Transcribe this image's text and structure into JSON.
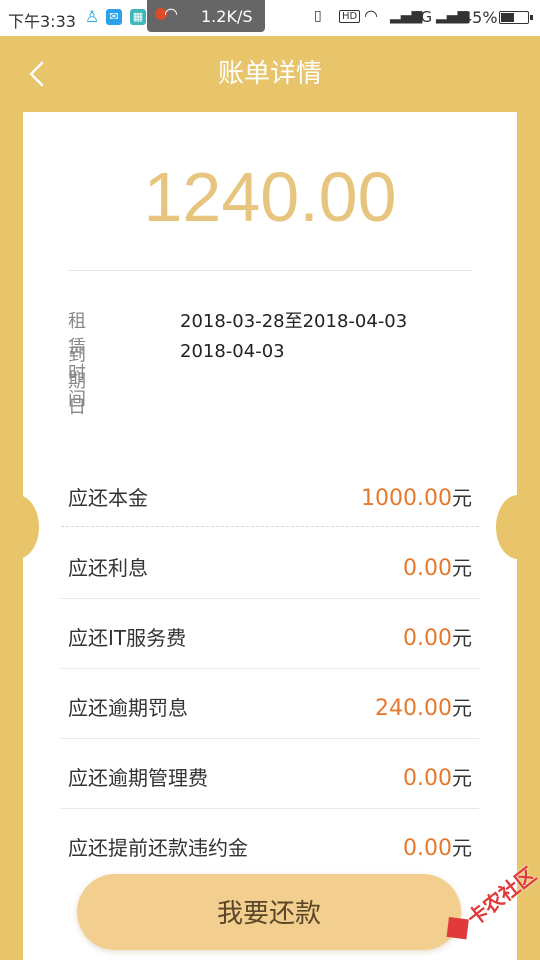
{
  "status_bar": {
    "time": "下午3:33",
    "net_speed": "1.2K/S",
    "hd": "HD",
    "network_type": "4G",
    "battery_percent": "45%",
    "battery_level": 0.45,
    "icons": [
      "qq-penguin-icon",
      "mail-icon",
      "qr-icon",
      "wifi-icon",
      "vibrate-icon",
      "signal-icon",
      "battery-icon"
    ]
  },
  "header": {
    "title": "账单详情",
    "back_icon": "chevron-left-icon"
  },
  "bill": {
    "amount": "1240.00",
    "info": [
      {
        "label": "租赁时间",
        "value": "2018-03-28至2018-04-03"
      },
      {
        "label": "到期日",
        "value": "2018-04-03"
      }
    ],
    "fees": [
      {
        "label": "应还本金",
        "amount": "1000.00",
        "unit": "元"
      },
      {
        "label": "应还利息",
        "amount": "0.00",
        "unit": "元"
      },
      {
        "label": "应还IT服务费",
        "amount": "0.00",
        "unit": "元"
      },
      {
        "label": "应还逾期罚息",
        "amount": "240.00",
        "unit": "元"
      },
      {
        "label": "应还逾期管理费",
        "amount": "0.00",
        "unit": "元"
      },
      {
        "label": "应还提前还款违约金",
        "amount": "0.00",
        "unit": "元"
      }
    ]
  },
  "actions": {
    "pay_label": "我要还款"
  },
  "watermark": {
    "text": "卡农社区"
  },
  "colors": {
    "background": "#E8C46B",
    "amount": "#E8C57E",
    "fee_amount": "#E8782C",
    "button": "#F2CE8F"
  }
}
